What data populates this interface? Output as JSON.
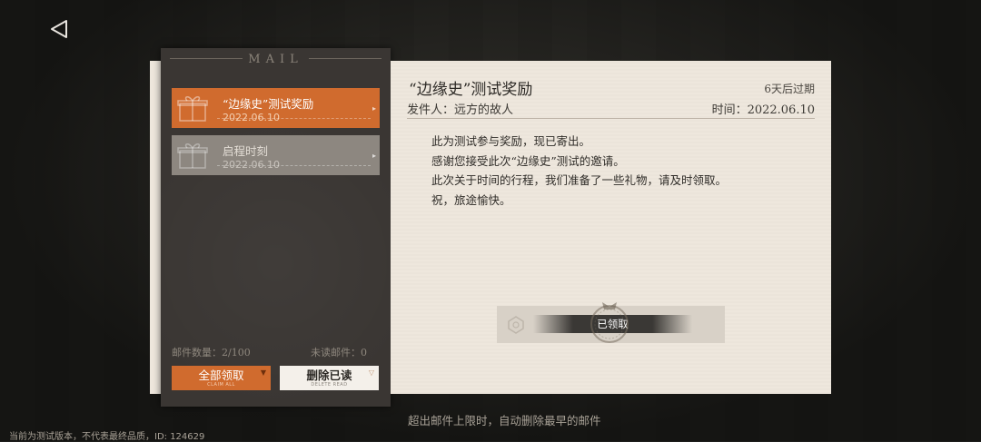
{
  "nav": {
    "back_icon": "back-triangle-icon"
  },
  "mail_panel": {
    "title": "MAIL",
    "items": [
      {
        "subject": "“边缘史”测试奖励",
        "date": "2022.06.10",
        "state": "selected",
        "color": "#d06b2e",
        "icon": "gift-icon"
      },
      {
        "subject": "启程时刻",
        "date": "2022.06.10",
        "state": "read",
        "color": "#8d8780",
        "icon": "gift-icon"
      }
    ],
    "mail_count_label": "邮件数量：2/100",
    "unread_label": "未读邮件：0",
    "claim_all": {
      "label": "全部领取",
      "sub": "CLAIM ALL"
    },
    "delete_read": {
      "label": "删除已读",
      "sub": "DELETE READ"
    }
  },
  "letter": {
    "title": "“边缘史”测试奖励",
    "expiry": "6天后过期",
    "sender_label": "发件人：远方的故人",
    "time_label": "时间：2022.06.10",
    "body": [
      "此为测试参与奖励，现已寄出。",
      "感谢您接受此次“边缘史”测试的邀请。",
      "此次关于时间的行程，我们准备了一些礼物，请及时领取。",
      "祝，旅途愉快。"
    ],
    "claimed_label": "已领取"
  },
  "footer": {
    "hint": "超出邮件上限时，自动删除最早的邮件",
    "version": "当前为测试版本，不代表最终品质，ID: 124629"
  },
  "colors": {
    "accent": "#d06b2e",
    "panel": "#3a3633",
    "paper": "#eee7dd"
  }
}
